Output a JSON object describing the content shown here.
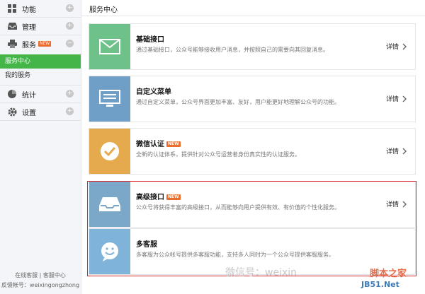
{
  "sidebar": {
    "items": [
      {
        "key": "func",
        "label": "功能",
        "icon": "grid-icon"
      },
      {
        "key": "manage",
        "label": "管理",
        "icon": "inbox-icon"
      },
      {
        "key": "service",
        "label": "服务",
        "icon": "printer-icon",
        "badge": "NEW"
      }
    ],
    "sub_items": [
      {
        "label": "服务中心",
        "active": true
      },
      {
        "label": "我的服务",
        "active": false
      }
    ],
    "items_bottom": [
      {
        "key": "stats",
        "label": "统计",
        "icon": "pie-icon"
      },
      {
        "key": "settings",
        "label": "设置",
        "icon": "gear-icon"
      }
    ],
    "footer_line1": "在线客服 | 客服中心",
    "footer_line2": "反馈帐号：weixingongzhong"
  },
  "header": {
    "title": "服务中心"
  },
  "services": [
    {
      "title": "基础接口",
      "desc": "通过基础接口，公众号能够接收用户消息，并按照自己的需要向其回复消息。",
      "detail": "详情",
      "color": "#6fc18a",
      "icon": "envelope-icon"
    },
    {
      "title": "自定义菜单",
      "desc": "通过自定义菜单，公众号界面更加丰富、友好，用户能更好地理解公众号的功能。",
      "detail": "详情",
      "color": "#6f9fc6",
      "icon": "monitor-icon"
    },
    {
      "title": "微信认证",
      "badge": "NEW",
      "desc": "全新的认证体系，提供针对公众号运营者身份真实性的认证服务。",
      "detail": "详情",
      "color": "#e5a94e",
      "icon": "check-icon"
    },
    {
      "title": "高级接口",
      "badge": "NEW",
      "desc": "公众号将获得丰富的高级接口，从而能够向用户提供有效、有价值的个性化服务。",
      "detail": "详情",
      "color": "#7ba7c9",
      "icon": "tray-icon"
    },
    {
      "title": "多客服",
      "desc": "多客服为公众帐号提供多客服功能，支持多人同时为一个公众号提供客服服务。",
      "detail": "",
      "color": "#7fb3d9",
      "icon": "smiley-icon"
    }
  ],
  "watermarks": {
    "wechat": "微信号：weixin",
    "site1": "脚本之家",
    "site2": "JB51.Net"
  }
}
